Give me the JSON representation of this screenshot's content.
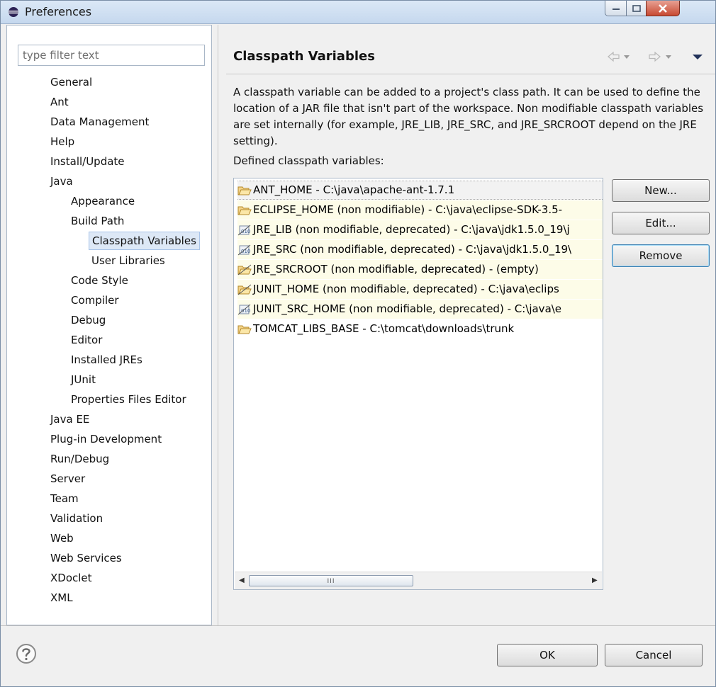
{
  "window": {
    "title": "Preferences"
  },
  "filter": {
    "placeholder": "type filter text"
  },
  "tree": {
    "items": [
      {
        "label": "General"
      },
      {
        "label": "Ant"
      },
      {
        "label": "Data Management"
      },
      {
        "label": "Help"
      },
      {
        "label": "Install/Update"
      },
      {
        "label": "Java"
      },
      {
        "label": "Appearance"
      },
      {
        "label": "Build Path"
      },
      {
        "label": "Classpath Variables",
        "selected": true
      },
      {
        "label": "User Libraries"
      },
      {
        "label": "Code Style"
      },
      {
        "label": "Compiler"
      },
      {
        "label": "Debug"
      },
      {
        "label": "Editor"
      },
      {
        "label": "Installed JREs"
      },
      {
        "label": "JUnit"
      },
      {
        "label": "Properties Files Editor"
      },
      {
        "label": "Java EE"
      },
      {
        "label": "Plug-in Development"
      },
      {
        "label": "Run/Debug"
      },
      {
        "label": "Server"
      },
      {
        "label": "Team"
      },
      {
        "label": "Validation"
      },
      {
        "label": "Web"
      },
      {
        "label": "Web Services"
      },
      {
        "label": "XDoclet"
      },
      {
        "label": "XML"
      }
    ]
  },
  "page": {
    "title": "Classpath Variables",
    "description": "A classpath variable can be added to a project's class path. It can be used to define the location of a JAR file that isn't part of the workspace. Non modifiable classpath variables are set internally (for example, JRE_LIB, JRE_SRC, and JRE_SRCROOT depend on the JRE setting).",
    "list_label": "Defined classpath variables:"
  },
  "variables": [
    {
      "text": "ANT_HOME - C:\\java\\apache-ant-1.7.1",
      "icon": "folder-icon",
      "selected": true
    },
    {
      "text": "ECLIPSE_HOME (non modifiable) - C:\\java\\eclipse-SDK-3.5-",
      "icon": "folder-icon"
    },
    {
      "text": "JRE_LIB (non modifiable, deprecated) - C:\\java\\jdk1.5.0_19\\j",
      "icon": "jar-icon"
    },
    {
      "text": "JRE_SRC (non modifiable, deprecated) - C:\\java\\jdk1.5.0_19\\",
      "icon": "jar-icon"
    },
    {
      "text": "JRE_SRCROOT (non modifiable, deprecated) - (empty)",
      "icon": "folder-deprecated-icon"
    },
    {
      "text": "JUNIT_HOME (non modifiable, deprecated) - C:\\java\\eclips",
      "icon": "folder-deprecated-icon"
    },
    {
      "text": "JUNIT_SRC_HOME (non modifiable, deprecated) - C:\\java\\e",
      "icon": "jar-icon"
    },
    {
      "text": "TOMCAT_LIBS_BASE - C:\\tomcat\\downloads\\trunk",
      "icon": "folder-icon"
    }
  ],
  "buttons": {
    "new": "New...",
    "edit": "Edit...",
    "remove": "Remove",
    "ok": "OK",
    "cancel": "Cancel"
  },
  "scrollbar": {
    "grip": "III"
  },
  "colors": {
    "selection": "#dde8f6",
    "non_modifiable_row": "#fdfce8",
    "close_button": "#c84a32"
  }
}
